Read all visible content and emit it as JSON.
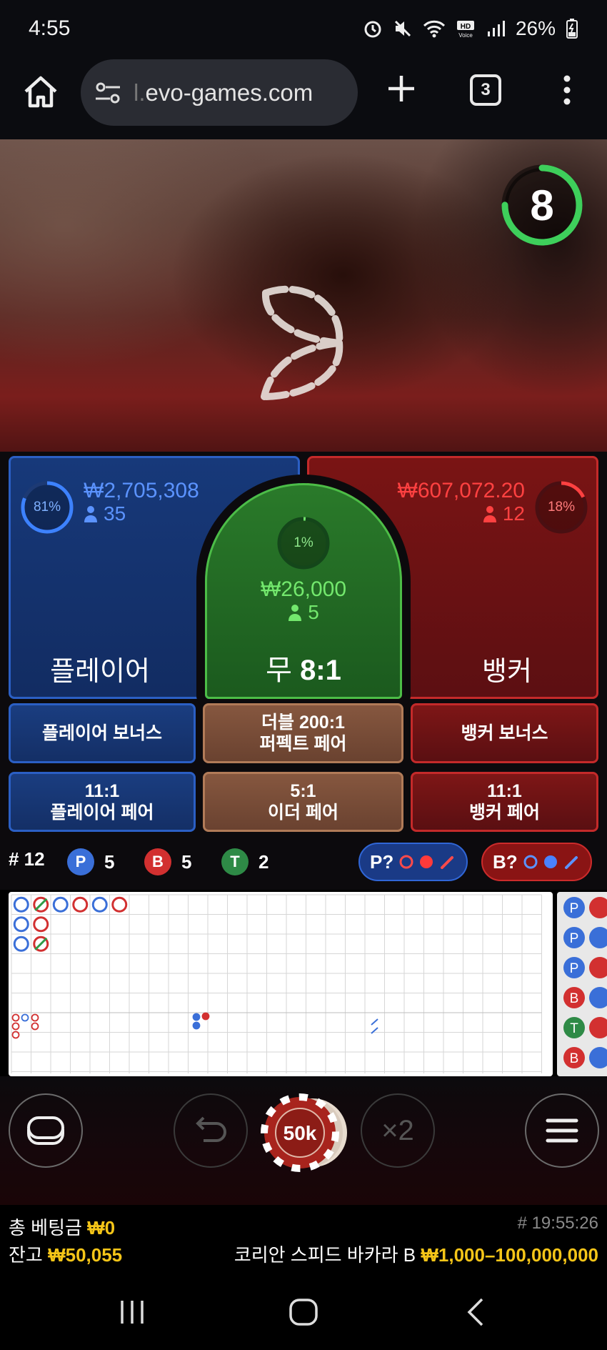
{
  "status": {
    "time": "4:55",
    "battery": "26%"
  },
  "browser": {
    "url": "evo-games.com",
    "url_prefix": "l.",
    "tab_count": "3"
  },
  "game": {
    "countdown": "8",
    "player": {
      "label": "플레이어",
      "percent": "81%",
      "percent_value": 0.81,
      "amount": "₩2,705,308",
      "bettors": "35"
    },
    "tie": {
      "label_prefix": "무",
      "label_odds": "8:1",
      "percent": "1%",
      "percent_value": 0.01,
      "amount": "₩26,000",
      "bettors": "5"
    },
    "banker": {
      "label": "뱅커",
      "percent": "18%",
      "percent_value": 0.18,
      "amount": "₩607,072.20",
      "bettors": "12"
    },
    "side_bets": {
      "player_bonus": "플레이어 보너스",
      "perfect_pair_line1": "더블 200:1",
      "perfect_pair_line2": "퍼펙트 페어",
      "banker_bonus": "뱅커 보너스",
      "player_pair_line1": "11:1",
      "player_pair_line2": "플레이어 페어",
      "either_pair_line1": "5:1",
      "either_pair_line2": "이더 페어",
      "banker_pair_line1": "11:1",
      "banker_pair_line2": "뱅커 페어"
    }
  },
  "stats": {
    "round_label": "# 12",
    "player_badge": "P",
    "player_count": "5",
    "banker_badge": "B",
    "banker_count": "5",
    "tie_badge": "T",
    "tie_count": "2",
    "player_predict": "P?",
    "banker_predict": "B?"
  },
  "road": {
    "big_road_marks": [
      {
        "col": 0,
        "row": 0,
        "color": "#3a6fd8",
        "tie": false
      },
      {
        "col": 1,
        "row": 0,
        "color": "#d23030",
        "tie": true
      },
      {
        "col": 2,
        "row": 0,
        "color": "#3a6fd8",
        "tie": false
      },
      {
        "col": 3,
        "row": 0,
        "color": "#d23030",
        "tie": false
      },
      {
        "col": 4,
        "row": 0,
        "color": "#3a6fd8",
        "tie": false
      },
      {
        "col": 5,
        "row": 0,
        "color": "#d23030",
        "tie": false
      },
      {
        "col": 0,
        "row": 1,
        "color": "#3a6fd8",
        "tie": false
      },
      {
        "col": 1,
        "row": 1,
        "color": "#d23030",
        "tie": false
      },
      {
        "col": 0,
        "row": 2,
        "color": "#3a6fd8",
        "tie": false
      },
      {
        "col": 1,
        "row": 2,
        "color": "#d23030",
        "tie": true
      }
    ],
    "bead_side": [
      "P",
      "P",
      "P",
      "B",
      "T",
      "B"
    ]
  },
  "controls": {
    "chip_value": "50k",
    "double_label": "×2"
  },
  "footer": {
    "total_bet_label": "총 베팅금",
    "total_bet_value": "₩0",
    "balance_label": "잔고",
    "balance_value": "₩50,055",
    "round_id": "# 19:55:26",
    "table_name": "코리안 스피드 바카라 B",
    "limits": "₩1,000–100,000,000"
  },
  "colors": {
    "player_blue": "#2b5fc4",
    "banker_red": "#c42a2a",
    "tie_green": "#4cbd47",
    "gold": "#f5c518"
  }
}
